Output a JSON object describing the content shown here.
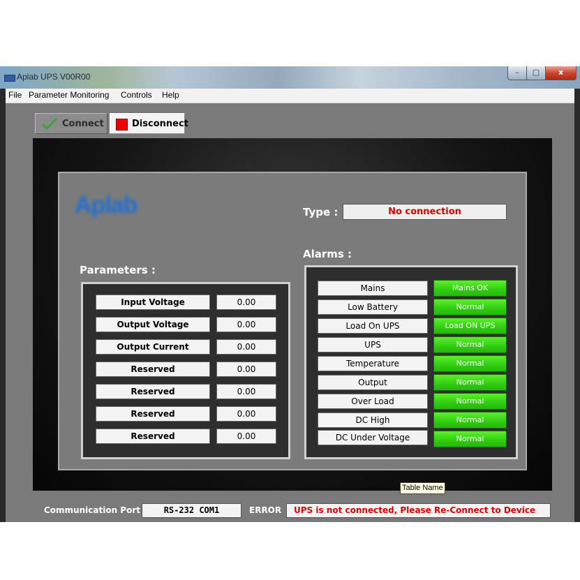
{
  "window": {
    "title": "Aplab UPS V00R00",
    "controls": {
      "minimize": "–",
      "maximize": "□",
      "close": "x"
    }
  },
  "menu": {
    "items": [
      "File",
      "Parameter Monitoring",
      "Controls",
      "Help"
    ]
  },
  "toolbar": {
    "connect_label": "Connect",
    "disconnect_label": "Disconnect",
    "connect_icon": "checkmark-icon",
    "disconnect_icon": "stop-icon"
  },
  "logo": "Aplab",
  "type": {
    "label": "Type :",
    "value": "No connection"
  },
  "parameters": {
    "title": "Parameters :",
    "rows": [
      {
        "label": "Input Voltage",
        "value": "0.00"
      },
      {
        "label": "Output Voltage",
        "value": "0.00"
      },
      {
        "label": "Output Current",
        "value": "0.00"
      },
      {
        "label": "Reserved",
        "value": "0.00"
      },
      {
        "label": "Reserved",
        "value": "0.00"
      },
      {
        "label": "Reserved",
        "value": "0.00"
      },
      {
        "label": "Reserved",
        "value": "0.00"
      }
    ]
  },
  "alarms": {
    "title": "Alarms :",
    "rows": [
      {
        "label": "Mains",
        "status": "Mains OK"
      },
      {
        "label": "Low Battery",
        "status": "Normal"
      },
      {
        "label": "Load On UPS",
        "status": "Load ON UPS"
      },
      {
        "label": "UPS",
        "status": "Normal"
      },
      {
        "label": "Temperature",
        "status": "Normal"
      },
      {
        "label": "Output",
        "status": "Normal"
      },
      {
        "label": "Over Load",
        "status": "Normal"
      },
      {
        "label": "DC High",
        "status": "Normal"
      },
      {
        "label": "DC Under Voltage",
        "status": "Normal"
      }
    ]
  },
  "tooltip": "Table Name",
  "statusbar": {
    "port_label": "Communication Port",
    "port_value": "RS-232  COM1",
    "error_label": "ERROR",
    "error_value": "UPS is not connected, Please Re-Connect to Device"
  },
  "colors": {
    "status_ok": "#3ad814",
    "error_text": "#e00000",
    "panel_bg": "#7b7b7b",
    "logo": "#1f6fd6"
  }
}
